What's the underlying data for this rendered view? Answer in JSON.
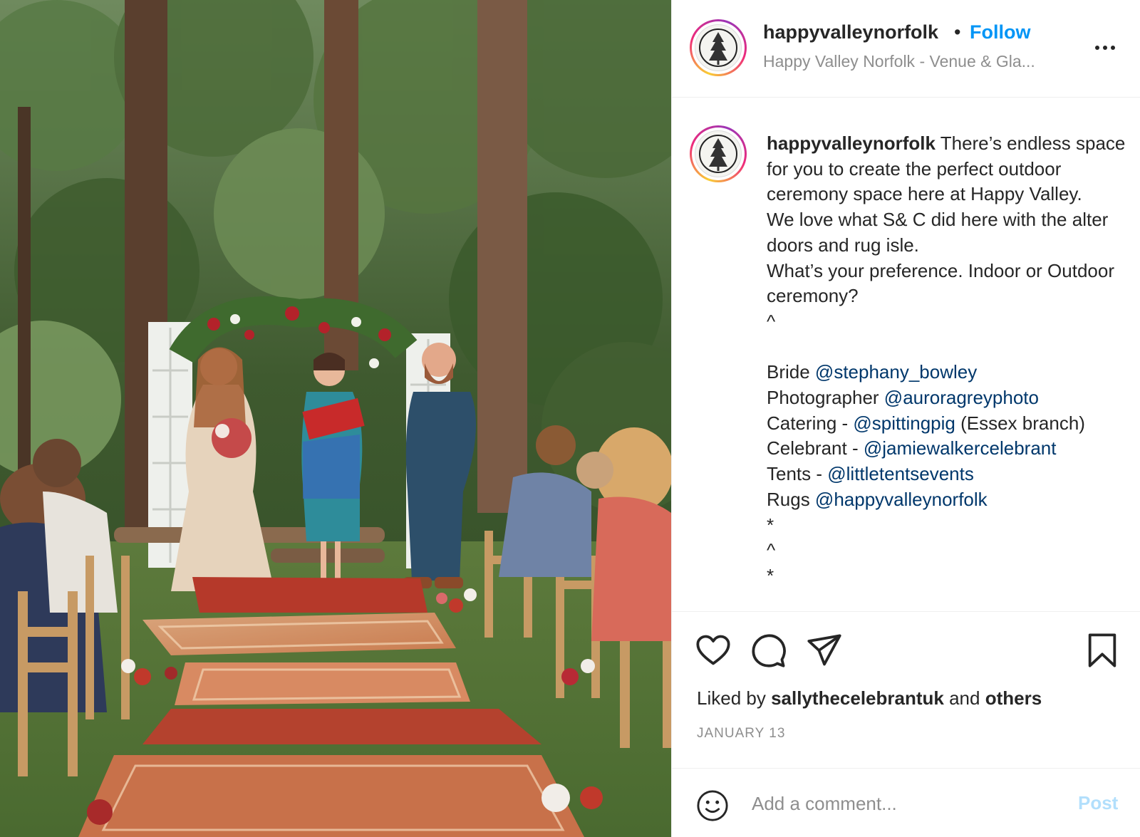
{
  "header": {
    "username": "happyvalleynorfolk",
    "separator": "•",
    "follow_label": "Follow",
    "subtitle": "Happy Valley Norfolk - Venue & Gla..."
  },
  "caption": {
    "username": "happyvalleynorfolk",
    "lines": [
      {
        "text": " There’s endless space for you to create the perfect outdoor ceremony space here at Happy Valley.\nWe love what S& C did here with the alter doors and rug isle.\nWhat’s your preference. Indoor or Outdoor ceremony?\n^\n\n"
      },
      {
        "prefix": "Bride ",
        "mention": "@stephany_bowley",
        "suffix": "\n"
      },
      {
        "prefix": "Photographer ",
        "mention": "@auroragreyphoto",
        "suffix": "\n"
      },
      {
        "prefix": "Catering - ",
        "mention": "@spittingpig",
        "suffix": " (Essex branch)\n"
      },
      {
        "prefix": "Celebrant - ",
        "mention": "@jamiewalkercelebrant",
        "suffix": "\n"
      },
      {
        "prefix": "Tents - ",
        "mention": "@littletentsevents",
        "suffix": "\n"
      },
      {
        "prefix": "Rugs ",
        "mention": "@happyvalleynorfolk",
        "suffix": "\n*\n^\n*"
      }
    ]
  },
  "likes": {
    "prefix": "Liked by ",
    "user": "sallythecelebrantuk",
    "middle": " and ",
    "others": "others"
  },
  "date": "JANUARY 13",
  "comment": {
    "placeholder": "Add a comment...",
    "post_label": "Post"
  },
  "icons": {
    "like": "heart-icon",
    "comment": "comment-icon",
    "share": "share-icon",
    "save": "bookmark-icon",
    "emoji": "emoji-icon",
    "more": "more-options-icon"
  },
  "colors": {
    "follow": "#0095f6",
    "mention": "#00376b",
    "post_disabled": "#b2dffc",
    "muted": "#8e8e8e"
  }
}
